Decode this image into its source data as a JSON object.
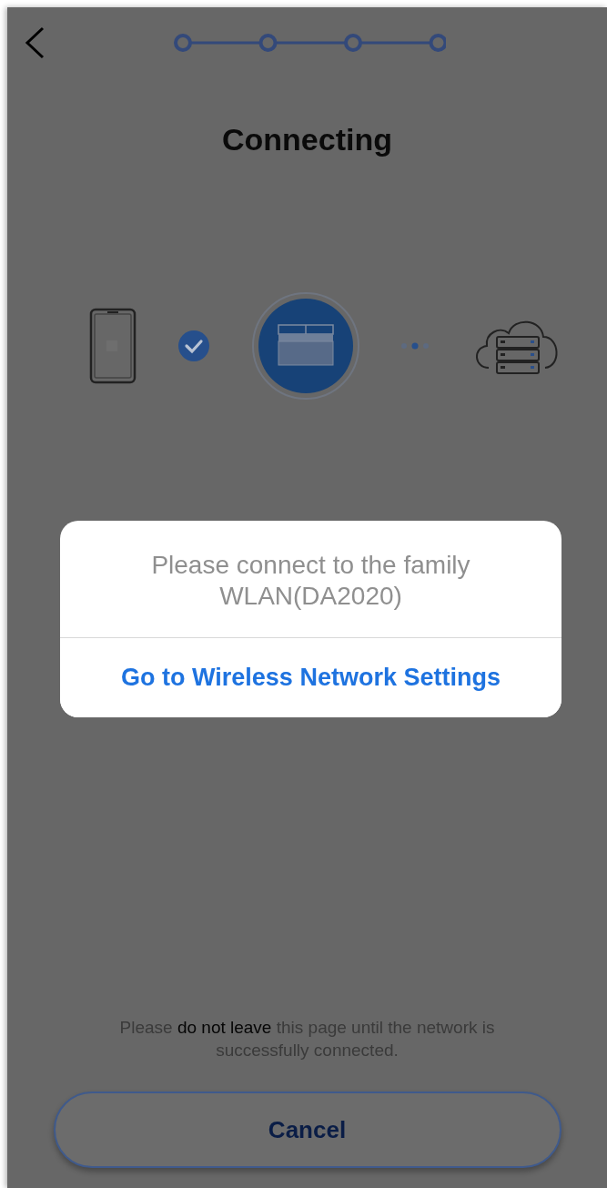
{
  "header": {
    "title": "Connecting"
  },
  "dialog": {
    "message": "Please connect to the family WLAN(DA2020)",
    "action": "Go to Wireless Network Settings"
  },
  "notice": "Please **do not leave** this page until the network is successfully connected.",
  "cancel_button": "Cancel"
}
